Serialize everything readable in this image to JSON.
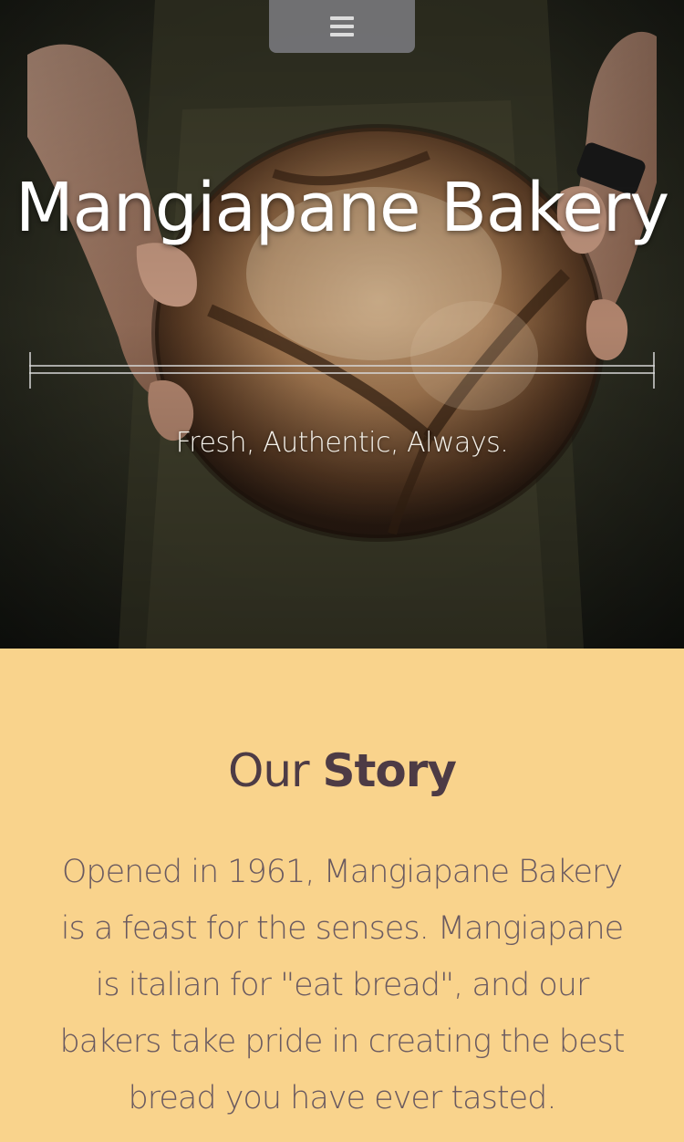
{
  "hero": {
    "title": "Mangiapane Bakery",
    "tagline": "Fresh, Authentic, Always."
  },
  "nav": {
    "icon": "menu-icon"
  },
  "story": {
    "heading_light": "Our",
    "heading_strong": "Story",
    "body": "Opened in 1961, Mangiapane Bakery is a feast for the senses. Mangiapane is italian for \"eat bread\", and our bakers take pride in creating the best bread you have ever tasted."
  },
  "colors": {
    "story_background": "#f9d38c",
    "heading_text": "#4d3b45",
    "body_text": "#6a5a60",
    "hero_text": "#ffffff"
  }
}
